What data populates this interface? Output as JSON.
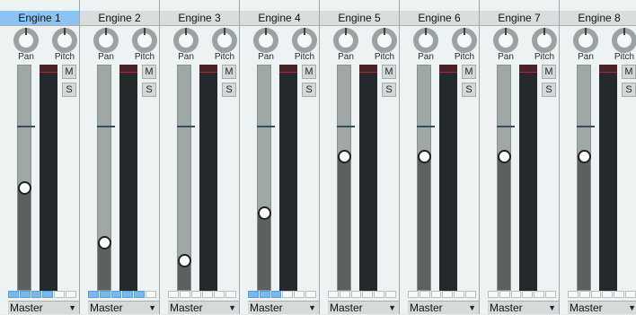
{
  "mixer": {
    "strips": [
      {
        "title": "Engine 1",
        "selected": true,
        "fader_level": 0.46,
        "routing_on": 4,
        "output": "Master",
        "pan_label": "Pan",
        "pitch_label": "Pitch",
        "mute_label": "M",
        "solo_label": "S"
      },
      {
        "title": "Engine 2",
        "selected": false,
        "fader_level": 0.22,
        "routing_on": 5,
        "output": "Master",
        "pan_label": "Pan",
        "pitch_label": "Pitch",
        "mute_label": "M",
        "solo_label": "S"
      },
      {
        "title": "Engine 3",
        "selected": false,
        "fader_level": 0.14,
        "routing_on": 0,
        "output": "Master",
        "pan_label": "Pan",
        "pitch_label": "Pitch",
        "mute_label": "M",
        "solo_label": "S"
      },
      {
        "title": "Engine 4",
        "selected": false,
        "fader_level": 0.35,
        "routing_on": 3,
        "output": "Master",
        "pan_label": "Pan",
        "pitch_label": "Pitch",
        "mute_label": "M",
        "solo_label": "S"
      },
      {
        "title": "Engine 5",
        "selected": false,
        "fader_level": 0.6,
        "routing_on": 0,
        "output": "Master",
        "pan_label": "Pan",
        "pitch_label": "Pitch",
        "mute_label": "M",
        "solo_label": "S"
      },
      {
        "title": "Engine 6",
        "selected": false,
        "fader_level": 0.6,
        "routing_on": 0,
        "output": "Master",
        "pan_label": "Pan",
        "pitch_label": "Pitch",
        "mute_label": "M",
        "solo_label": "S"
      },
      {
        "title": "Engine 7",
        "selected": false,
        "fader_level": 0.6,
        "routing_on": 0,
        "output": "Master",
        "pan_label": "Pan",
        "pitch_label": "Pitch",
        "mute_label": "M",
        "solo_label": "S"
      },
      {
        "title": "Engine 8",
        "selected": false,
        "fader_level": 0.6,
        "routing_on": 0,
        "output": "Master",
        "pan_label": "Pan",
        "pitch_label": "Pitch",
        "mute_label": "M",
        "solo_label": "S"
      }
    ],
    "colors": {
      "selected_title": "#8dc3f2",
      "routing_on": "#79b7ec",
      "meter_bg": "#242a2b",
      "fader_track": "#5b6161"
    },
    "icons": {
      "knob": "rotary-knob-icon",
      "dropdown": "triangle-down-icon"
    }
  }
}
